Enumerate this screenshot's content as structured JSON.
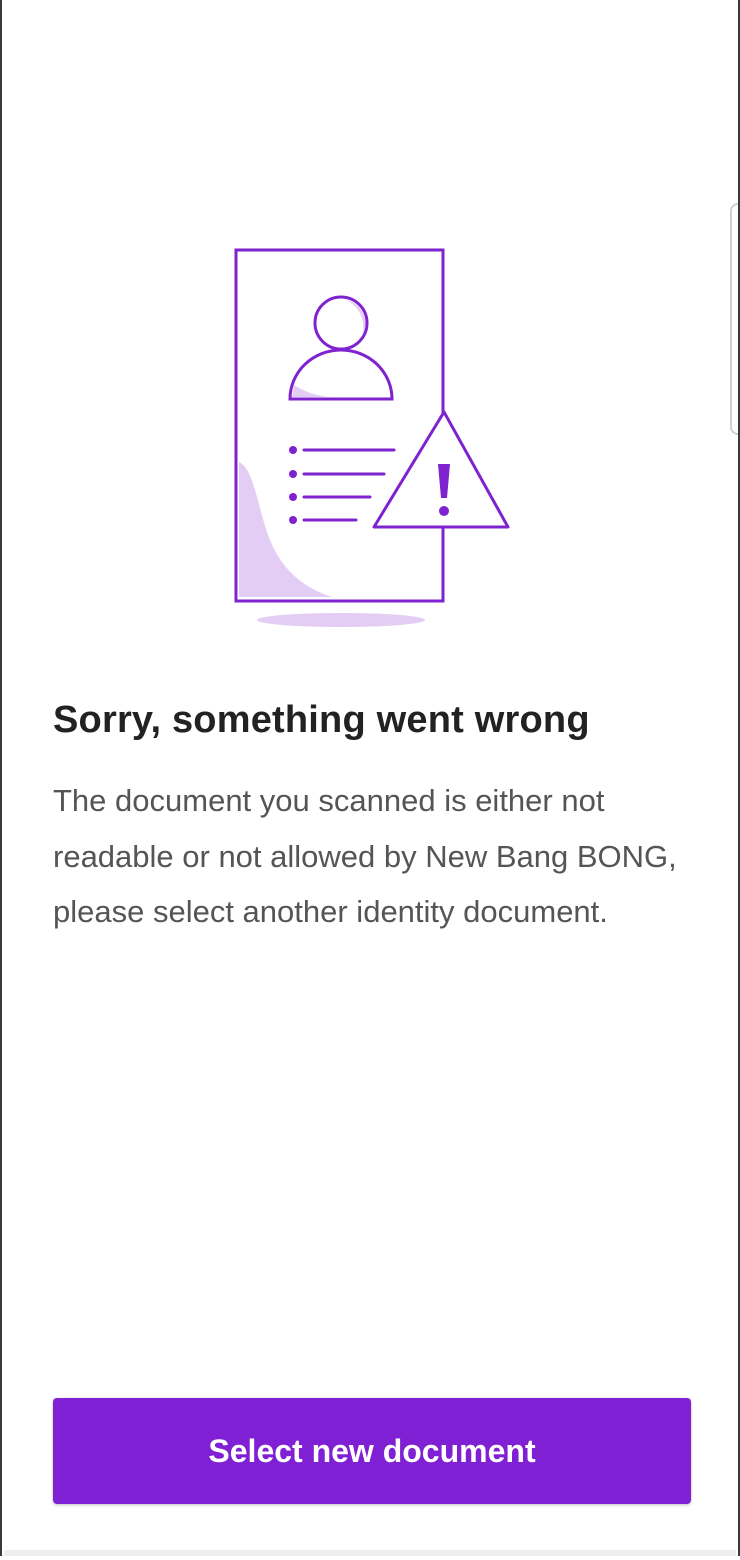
{
  "colors": {
    "accent": "#8020d5",
    "illustration_stroke": "#7f22d0",
    "illustration_fill": "#e3cdf4",
    "title": "#222222",
    "body_text": "#555555"
  },
  "illustration": {
    "icon": "document-warning-illustration"
  },
  "error": {
    "title": "Sorry, something went wrong",
    "message": "The document you scanned is either not readable or not allowed by New Bang BONG, please select another identity document."
  },
  "actions": {
    "primary_label": "Select new document"
  }
}
